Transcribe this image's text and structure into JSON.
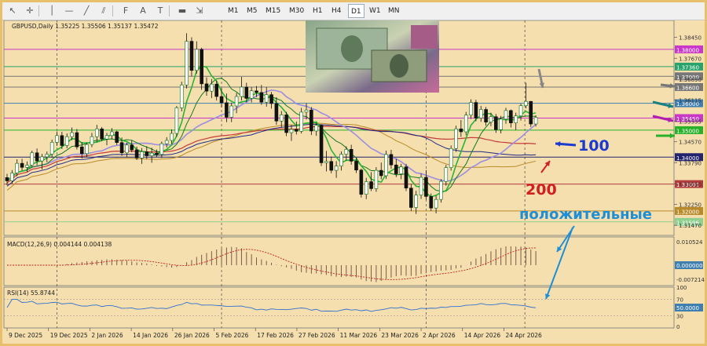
{
  "toolbar": {
    "tools": [
      {
        "name": "cursor-icon",
        "glyph": "↖"
      },
      {
        "name": "crosshair-icon",
        "glyph": "✛"
      },
      {
        "name": "vertical-line-icon",
        "glyph": "│"
      },
      {
        "name": "horizontal-line-icon",
        "glyph": "—"
      },
      {
        "name": "trend-line-icon",
        "glyph": "╱"
      },
      {
        "name": "channel-icon",
        "glyph": "⫽"
      },
      {
        "name": "fibonacci-icon",
        "glyph": "F"
      },
      {
        "name": "text-icon",
        "glyph": "A"
      },
      {
        "name": "text-label-icon",
        "glyph": "T"
      },
      {
        "name": "shapes-icon",
        "glyph": "▬"
      },
      {
        "name": "arrows-icon",
        "glyph": "⇲"
      }
    ],
    "timeframes": [
      "M1",
      "M5",
      "M15",
      "M30",
      "H1",
      "H4",
      "D1",
      "W1",
      "MN"
    ],
    "active_timeframe": "D1"
  },
  "colors": {
    "background": "#f5dfae",
    "bull": "#21a82a",
    "bear": "#111111",
    "ma_fast": "#27b534",
    "ma_mid": "#147a1f",
    "ma100": "#9b8ee0",
    "ma200": "#c43c3c",
    "ma_long": "#b98a2a",
    "ma_navy": "#232a86",
    "signal": "#c02020",
    "arrow_blue": "#1a3ad0",
    "text_blue": "#1e8fd6"
  },
  "chart_data": {
    "type": "candlestick",
    "header": "GBPUSD,Daily  1.35225 1.35506 1.35137 1.35472",
    "x_ticks": [
      "9 Dec 2025",
      "19 Dec 2025",
      "2 Jan 2026",
      "14 Jan 2026",
      "26 Jan 2026",
      "5 Feb 2026",
      "17 Feb 2026",
      "27 Feb 2026",
      "11 Mar 2026",
      "23 Mar 2026",
      "2 Apr 2026",
      "14 Apr 2026",
      "24 Apr 2026"
    ],
    "y_ticks": [
      1.3845,
      1.3767,
      1.3689,
      1.36115,
      1.35335,
      1.3457,
      1.3379,
      1.3301,
      1.3225,
      1.3147
    ],
    "y_range": [
      1.3127,
      1.3893
    ],
    "levels": [
      {
        "value": 1.38,
        "label": "1.38000",
        "color": "#c837c8"
      },
      {
        "value": 1.3736,
        "label": "1.37360",
        "color": "#27a36b"
      },
      {
        "value": 1.37,
        "label": "1.37000",
        "color": "#777777"
      },
      {
        "value": 1.366,
        "label": "1.36600",
        "color": "#777777"
      },
      {
        "value": 1.36,
        "label": "1.36000",
        "color": "#3f7fb0"
      },
      {
        "value": 1.3545,
        "label": "1.35450",
        "color": "#c837c8"
      },
      {
        "value": 1.35,
        "label": "1.35000",
        "color": "#28b028"
      },
      {
        "value": 1.34,
        "label": "1.34000",
        "color": "#23236e"
      },
      {
        "value": 1.33,
        "label": "1.33000",
        "color": "#b33b3b"
      },
      {
        "value": 1.32,
        "label": "1.32000",
        "color": "#b98a2a"
      },
      {
        "value": 1.31596,
        "label": "1.31596",
        "color": "#8fcf8f"
      }
    ],
    "candles": [
      [
        1.3324,
        1.3338,
        1.3296,
        1.3312
      ],
      [
        1.3312,
        1.3352,
        1.3302,
        1.3341
      ],
      [
        1.3341,
        1.3392,
        1.3329,
        1.3377
      ],
      [
        1.3377,
        1.3394,
        1.335,
        1.3362
      ],
      [
        1.3362,
        1.3384,
        1.3345,
        1.337
      ],
      [
        1.337,
        1.3424,
        1.3362,
        1.3416
      ],
      [
        1.3416,
        1.3432,
        1.337,
        1.3386
      ],
      [
        1.3386,
        1.3412,
        1.3354,
        1.3401
      ],
      [
        1.3401,
        1.3421,
        1.3381,
        1.3411
      ],
      [
        1.3411,
        1.3465,
        1.3398,
        1.3455
      ],
      [
        1.3455,
        1.3495,
        1.3442,
        1.348
      ],
      [
        1.348,
        1.3494,
        1.343,
        1.3443
      ],
      [
        1.3443,
        1.3488,
        1.3433,
        1.3476
      ],
      [
        1.3476,
        1.351,
        1.3463,
        1.3491
      ],
      [
        1.3491,
        1.3504,
        1.3428,
        1.3438
      ],
      [
        1.3438,
        1.3456,
        1.3395,
        1.3413
      ],
      [
        1.3413,
        1.3454,
        1.34,
        1.3447
      ],
      [
        1.3447,
        1.349,
        1.3437,
        1.3476
      ],
      [
        1.3476,
        1.352,
        1.3455,
        1.3505
      ],
      [
        1.3505,
        1.3512,
        1.3459,
        1.3467
      ],
      [
        1.3467,
        1.349,
        1.3444,
        1.348
      ],
      [
        1.348,
        1.3508,
        1.3466,
        1.3494
      ],
      [
        1.3494,
        1.3498,
        1.3445,
        1.3454
      ],
      [
        1.3454,
        1.3473,
        1.3405,
        1.3416
      ],
      [
        1.3416,
        1.3454,
        1.34,
        1.3445
      ],
      [
        1.3445,
        1.3463,
        1.3418,
        1.3427
      ],
      [
        1.3427,
        1.3439,
        1.3389,
        1.3397
      ],
      [
        1.3397,
        1.3434,
        1.3375,
        1.342
      ],
      [
        1.342,
        1.344,
        1.3393,
        1.3405
      ],
      [
        1.3405,
        1.3435,
        1.3379,
        1.3415
      ],
      [
        1.3415,
        1.3428,
        1.34,
        1.341
      ],
      [
        1.341,
        1.3458,
        1.3397,
        1.345
      ],
      [
        1.345,
        1.3474,
        1.3436,
        1.3462
      ],
      [
        1.3462,
        1.3503,
        1.3449,
        1.3488
      ],
      [
        1.3488,
        1.359,
        1.3476,
        1.3583
      ],
      [
        1.3583,
        1.368,
        1.357,
        1.3668
      ],
      [
        1.3668,
        1.386,
        1.3655,
        1.383
      ],
      [
        1.383,
        1.3845,
        1.37,
        1.3722
      ],
      [
        1.3722,
        1.383,
        1.371,
        1.38
      ],
      [
        1.38,
        1.3806,
        1.365,
        1.3672
      ],
      [
        1.3672,
        1.3696,
        1.3628,
        1.3645
      ],
      [
        1.3645,
        1.369,
        1.3619,
        1.3671
      ],
      [
        1.3671,
        1.3684,
        1.361,
        1.3625
      ],
      [
        1.3625,
        1.3656,
        1.3585,
        1.3602
      ],
      [
        1.3602,
        1.3636,
        1.353,
        1.3548
      ],
      [
        1.3548,
        1.3602,
        1.353,
        1.359
      ],
      [
        1.359,
        1.3638,
        1.3563,
        1.3625
      ],
      [
        1.3625,
        1.3698,
        1.361,
        1.366
      ],
      [
        1.366,
        1.3676,
        1.3604,
        1.3618
      ],
      [
        1.3618,
        1.366,
        1.3603,
        1.3646
      ],
      [
        1.3646,
        1.3664,
        1.3623,
        1.364
      ],
      [
        1.364,
        1.3668,
        1.3594,
        1.3604
      ],
      [
        1.3604,
        1.366,
        1.3587,
        1.3632
      ],
      [
        1.3632,
        1.3642,
        1.358,
        1.3599
      ],
      [
        1.3599,
        1.3622,
        1.352,
        1.3534
      ],
      [
        1.3534,
        1.3571,
        1.351,
        1.3557
      ],
      [
        1.3557,
        1.3568,
        1.3478,
        1.3491
      ],
      [
        1.3491,
        1.3519,
        1.346,
        1.3503
      ],
      [
        1.3503,
        1.3532,
        1.3484,
        1.3496
      ],
      [
        1.3496,
        1.3583,
        1.3488,
        1.3567
      ],
      [
        1.3567,
        1.36,
        1.354,
        1.3575
      ],
      [
        1.3575,
        1.3586,
        1.3482,
        1.3497
      ],
      [
        1.3497,
        1.3526,
        1.3479,
        1.3518
      ],
      [
        1.3518,
        1.3522,
        1.3367,
        1.3379
      ],
      [
        1.3379,
        1.3423,
        1.3347,
        1.3384
      ],
      [
        1.3384,
        1.3402,
        1.334,
        1.3351
      ],
      [
        1.3351,
        1.3385,
        1.3323,
        1.3367
      ],
      [
        1.3367,
        1.3421,
        1.335,
        1.3411
      ],
      [
        1.3411,
        1.344,
        1.3387,
        1.3429
      ],
      [
        1.3429,
        1.3446,
        1.3372,
        1.3385
      ],
      [
        1.3385,
        1.3397,
        1.3341,
        1.3352
      ],
      [
        1.3352,
        1.3357,
        1.325,
        1.3262
      ],
      [
        1.3262,
        1.3323,
        1.3244,
        1.3309
      ],
      [
        1.3309,
        1.3344,
        1.3274,
        1.3283
      ],
      [
        1.3283,
        1.3363,
        1.3271,
        1.3351
      ],
      [
        1.3351,
        1.338,
        1.3318,
        1.3331
      ],
      [
        1.3331,
        1.3424,
        1.3319,
        1.341
      ],
      [
        1.341,
        1.3427,
        1.3357,
        1.3371
      ],
      [
        1.3371,
        1.3394,
        1.3326,
        1.3338
      ],
      [
        1.3338,
        1.3375,
        1.3318,
        1.3364
      ],
      [
        1.3364,
        1.3375,
        1.3274,
        1.3285
      ],
      [
        1.3285,
        1.3299,
        1.32,
        1.3213
      ],
      [
        1.3213,
        1.3275,
        1.3189,
        1.3259
      ],
      [
        1.3259,
        1.3339,
        1.3245,
        1.3325
      ],
      [
        1.3325,
        1.3352,
        1.3242,
        1.3254
      ],
      [
        1.3254,
        1.3265,
        1.32,
        1.3211
      ],
      [
        1.3211,
        1.3257,
        1.3191,
        1.3243
      ],
      [
        1.3243,
        1.3318,
        1.3231,
        1.331
      ],
      [
        1.331,
        1.3371,
        1.3294,
        1.3361
      ],
      [
        1.3361,
        1.3443,
        1.335,
        1.3432
      ],
      [
        1.3432,
        1.3517,
        1.3419,
        1.3505
      ],
      [
        1.3505,
        1.3538,
        1.3475,
        1.3494
      ],
      [
        1.3494,
        1.3568,
        1.3481,
        1.3556
      ],
      [
        1.3556,
        1.3615,
        1.3542,
        1.3603
      ],
      [
        1.3603,
        1.3613,
        1.3533,
        1.3545
      ],
      [
        1.3545,
        1.359,
        1.3531,
        1.3577
      ],
      [
        1.3577,
        1.3586,
        1.3517,
        1.353
      ],
      [
        1.353,
        1.3565,
        1.3515,
        1.355
      ],
      [
        1.355,
        1.356,
        1.349,
        1.3502
      ],
      [
        1.3502,
        1.3553,
        1.3488,
        1.3541
      ],
      [
        1.3541,
        1.3583,
        1.3524,
        1.3573
      ],
      [
        1.3573,
        1.3577,
        1.351,
        1.3527
      ],
      [
        1.3527,
        1.3565,
        1.3501,
        1.3553
      ],
      [
        1.3553,
        1.3598,
        1.3536,
        1.3591
      ],
      [
        1.3591,
        1.3676,
        1.3581,
        1.3607
      ],
      [
        1.3607,
        1.3608,
        1.3512,
        1.3523
      ],
      [
        1.3523,
        1.3555,
        1.3514,
        1.3547
      ]
    ],
    "indicators": {
      "macd": {
        "label": "MACD(12,26,9) 0.004144 0.004138",
        "scale_max": "0.010524",
        "zero": "0.000000",
        "scale_min": "-0.007214"
      },
      "rsi": {
        "label": "RSI(14) 55.8744",
        "levels": [
          "100",
          "70",
          "50.0000",
          "30",
          "0"
        ],
        "current": 55.8744
      }
    }
  },
  "annotations": {
    "ma100_label": "100",
    "ma200_label": "200",
    "positive_label": "положительные"
  }
}
